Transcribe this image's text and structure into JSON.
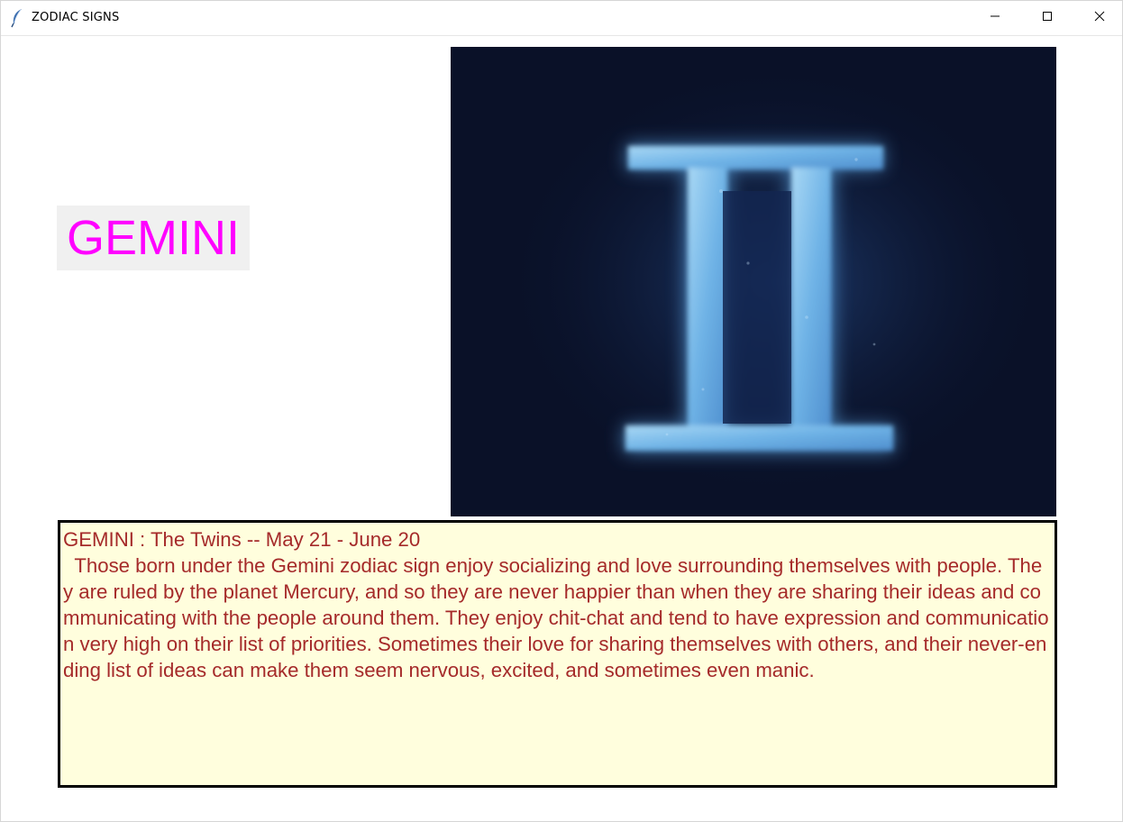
{
  "window": {
    "title": "ZODIAC SIGNS",
    "icon": "feather-icon",
    "controls": [
      "minimize-icon",
      "maximize-icon",
      "close-icon"
    ]
  },
  "sign": {
    "name": "GEMINI",
    "name_color": "#ff00ff",
    "image_icon": "gemini-symbol-icon"
  },
  "description": {
    "text": "GEMINI : The Twins -- May 21 - June 20\n  Those born under the Gemini zodiac sign enjoy socializing and love surrounding themselves with people. They are ruled by the planet Mercury, and so they are never happier than when they are sharing their ideas and communicating with the people around them. They enjoy chit-chat and tend to have expression and communication very high on their list of priorities. Sometimes their love for sharing themselves with others, and their never-ending list of ideas can make them seem nervous, excited, and sometimes even manic.",
    "text_color": "#a52a2a",
    "background": "#fffedd"
  }
}
